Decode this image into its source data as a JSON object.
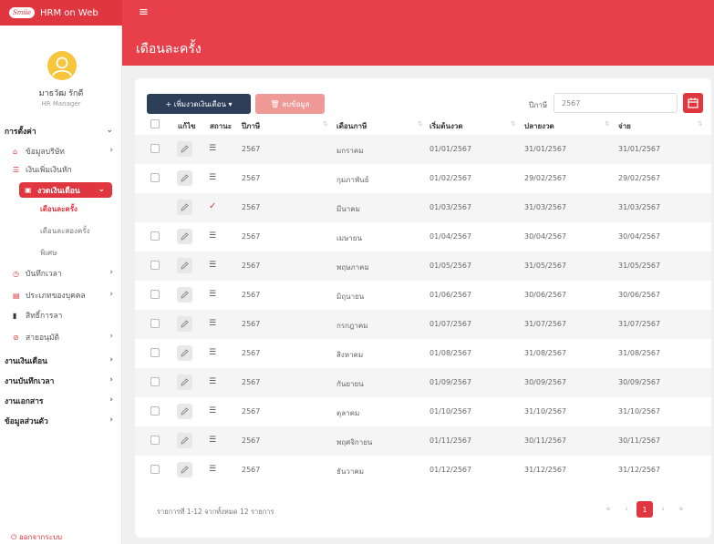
{
  "app": {
    "logo_text": "Smile",
    "title": "HRM on Web"
  },
  "user": {
    "name": "มาธวัฒ รักดี",
    "role": "HR Manager"
  },
  "sidebar": {
    "settings_label": "การตั้งค่า",
    "company_info": "ข้อมูลบริษัท",
    "income_deduction": "เงินเพิ่มเงินหัก",
    "salary_period": "งวดเงินเดือน",
    "sub_monthly": "เดือนละครั้ง",
    "sub_twice": "เดือนละสองครั้ง",
    "sub_special": "พิเศษ",
    "time_record": "บันทึกเวลา",
    "employee_type": "ประเภทของบุคคล",
    "leave_rights": "สิทธิ์การลา",
    "employee_status": "สายอนุมัติ",
    "payroll_work": "งานเงินเดือน",
    "time_work": "งานบันทึกเวลา",
    "document_work": "งานเอกสาร",
    "personal_info": "ข้อมูลส่วนตัว",
    "logout": "ออกจากระบบ"
  },
  "page": {
    "title": "เดือนละครั้ง"
  },
  "toolbar": {
    "add_label": "+ เพิ่มงวดเงินเดือน ▾",
    "delete_label": "🗑 ลบข้อมูล",
    "year_label": "ปีภาษี",
    "year_value": "2567"
  },
  "table": {
    "columns": {
      "edit": "แก้ไข",
      "status": "สถานะ",
      "year": "ปีภาษี",
      "month": "เดือนภาษี",
      "start": "เริ่มต้นงวด",
      "end": "ปลายงวด",
      "pay": "จ่าย"
    },
    "rows": [
      {
        "year": "2567",
        "month": "มกราคม",
        "start": "01/01/2567",
        "end": "31/01/2567",
        "pay": "31/01/2567"
      },
      {
        "year": "2567",
        "month": "กุมภาพันธ์",
        "start": "01/02/2567",
        "end": "29/02/2567",
        "pay": "29/02/2567"
      },
      {
        "year": "2567",
        "month": "มีนาคม",
        "start": "01/03/2567",
        "end": "31/03/2567",
        "pay": "31/03/2567"
      },
      {
        "year": "2567",
        "month": "เมษายน",
        "start": "01/04/2567",
        "end": "30/04/2567",
        "pay": "30/04/2567"
      },
      {
        "year": "2567",
        "month": "พฤษภาคม",
        "start": "01/05/2567",
        "end": "31/05/2567",
        "pay": "31/05/2567"
      },
      {
        "year": "2567",
        "month": "มิถุนายน",
        "start": "01/06/2567",
        "end": "30/06/2567",
        "pay": "30/06/2567"
      },
      {
        "year": "2567",
        "month": "กรกฎาคม",
        "start": "01/07/2567",
        "end": "31/07/2567",
        "pay": "31/07/2567"
      },
      {
        "year": "2567",
        "month": "สิงหาคม",
        "start": "01/08/2567",
        "end": "31/08/2567",
        "pay": "31/08/2567"
      },
      {
        "year": "2567",
        "month": "กันยายน",
        "start": "01/09/2567",
        "end": "30/09/2567",
        "pay": "30/09/2567"
      },
      {
        "year": "2567",
        "month": "ตุลาคม",
        "start": "01/10/2567",
        "end": "31/10/2567",
        "pay": "31/10/2567"
      },
      {
        "year": "2567",
        "month": "พฤศจิกายน",
        "start": "01/11/2567",
        "end": "30/11/2567",
        "pay": "30/11/2567"
      },
      {
        "year": "2567",
        "month": "ธันวาคม",
        "start": "01/12/2567",
        "end": "31/12/2567",
        "pay": "31/12/2567"
      }
    ]
  },
  "footer": {
    "info": "รายการที่ 1-12 จากทั้งหมด 12 รายการ"
  },
  "pagination": {
    "first": "«",
    "prev": "‹",
    "current": "1",
    "next": "›",
    "last": "»"
  },
  "colors": {
    "brand": "#e8404a",
    "brand_dark": "#e0363f",
    "navy": "#2d3e59",
    "avatar": "#f7c63c"
  }
}
